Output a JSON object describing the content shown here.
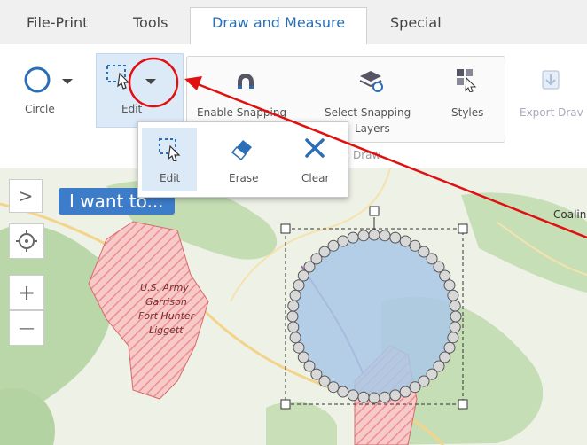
{
  "tabs": [
    "File-Print",
    "Tools",
    "Draw and Measure",
    "Special"
  ],
  "ribbon": {
    "circle_label": "Circle",
    "edit_label": "Edit",
    "enable_snapping_label": "Enable Snapping",
    "select_snapping_line1": "Select Snapping",
    "select_snapping_line2": "Layers",
    "styles_label": "Styles",
    "export_label": "Export Drav",
    "group_label": "Draw"
  },
  "edit_menu": {
    "edit": "Edit",
    "erase": "Erase",
    "clear": "Clear"
  },
  "map": {
    "i_want_label": "I want to...",
    "expand_glyph": ">",
    "zoom_in_glyph": "+",
    "zoom_out_glyph": "—",
    "place_label_lines": [
      "U.S. Army",
      "Garrison",
      "Fort Hunter",
      "Liggett"
    ],
    "city_label": "Coaling"
  },
  "colors": {
    "accent": "#2a6fb5",
    "annotation_red": "#e01010",
    "i_want_bg": "#3d7cc9",
    "circle_fill": "#a9c8e6",
    "military_hatch": "#f0a0a0"
  },
  "icons": {
    "circle": "circle-outline-icon",
    "edit": "edit-select-icon",
    "dropdown": "caret-down-icon",
    "snapping": "magnet-icon",
    "select_snapping": "layers-pointer-icon",
    "styles": "styles-grid-icon",
    "export": "export-download-icon",
    "erase": "eraser-icon",
    "clear": "close-x-icon",
    "locate": "locate-crosshair-icon"
  }
}
